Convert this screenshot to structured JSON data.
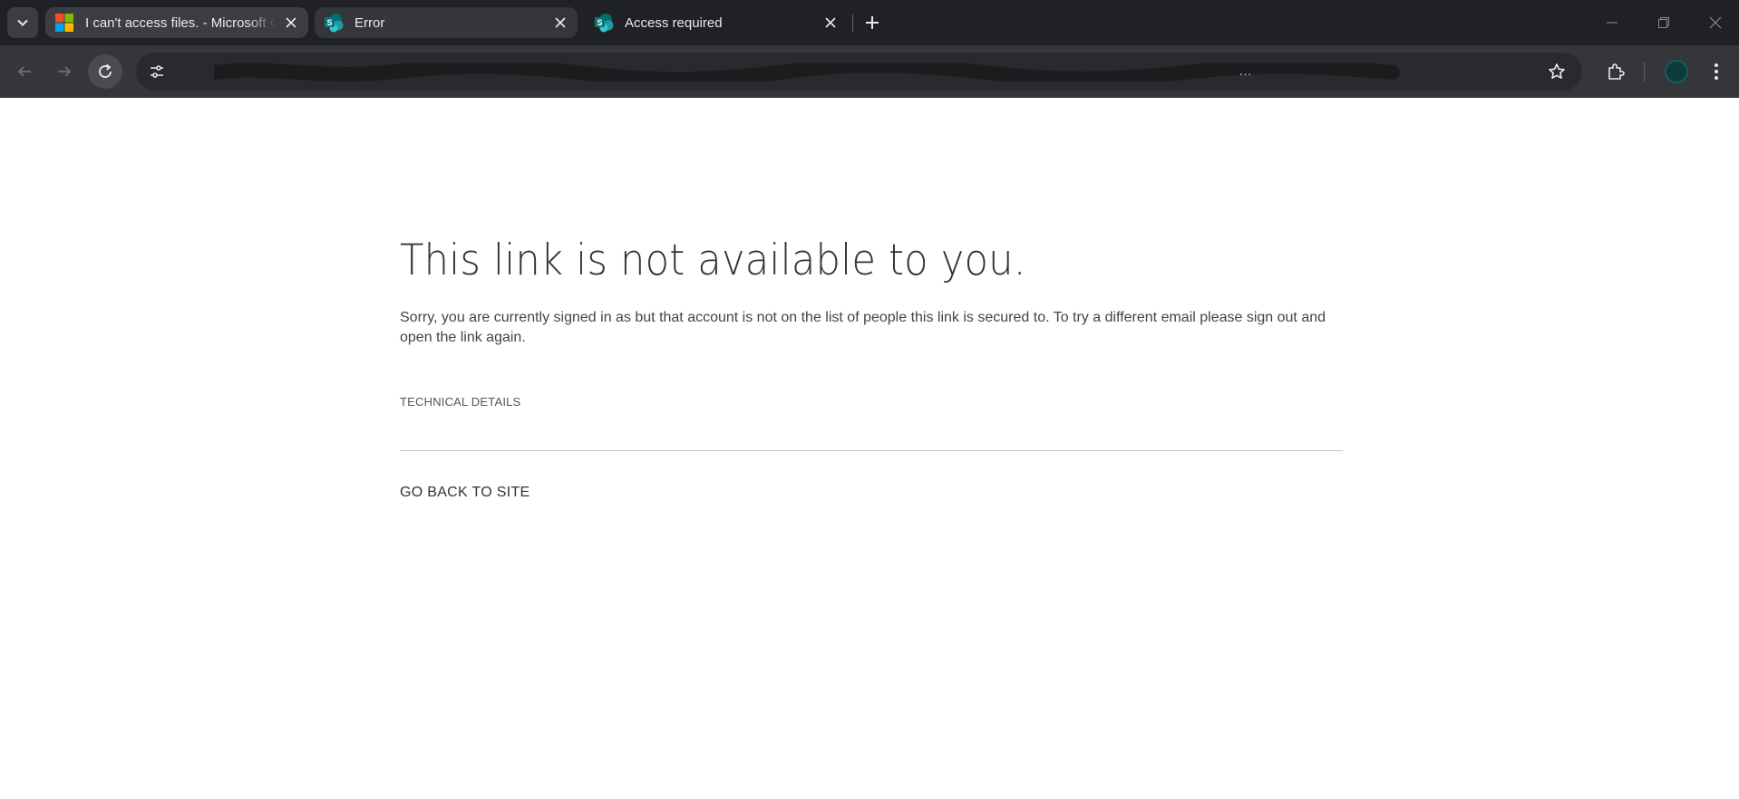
{
  "browser": {
    "tabs": [
      {
        "title": "I can't access files. - Microsoft C",
        "favicon": "microsoft-logo",
        "active": false
      },
      {
        "title": "Error",
        "favicon": "sharepoint-icon",
        "active": true
      },
      {
        "title": "Access required",
        "favicon": "sharepoint-icon",
        "active": false
      }
    ],
    "url_visible_tail": "…",
    "colors": {
      "tabstrip": "#202124",
      "toolbar": "#35363a",
      "omnibox": "#282a2d",
      "text": "#e8eaed"
    }
  },
  "page": {
    "heading": "This link is not available to you.",
    "message": "Sorry, you are currently signed in as  but that account is not on the list of people this link is secured to. To try a different email please sign out and open the link again.",
    "technical_details": "TECHNICAL DETAILS",
    "go_back": "GO BACK TO SITE"
  }
}
